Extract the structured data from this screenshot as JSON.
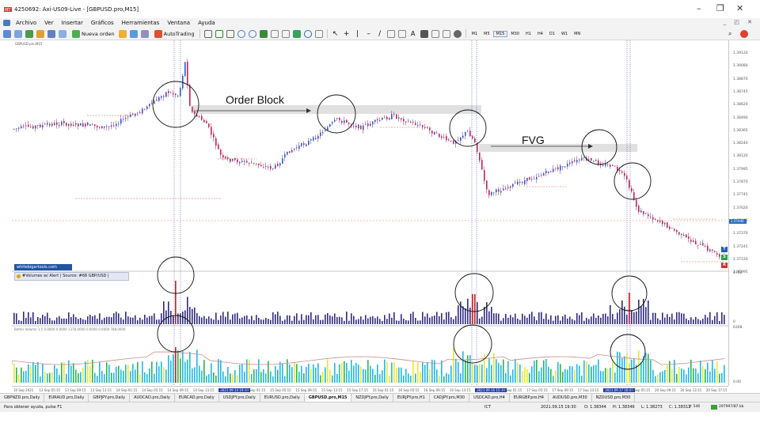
{
  "window": {
    "title": "4250692: Axi-US09-Live - [GBPUSD.pro,M15]",
    "minimize": "–",
    "maximize": "❐",
    "close": "✕"
  },
  "menu": {
    "items": [
      "Archivo",
      "Ver",
      "Insertar",
      "Gráficos",
      "Herramientas",
      "Ventana",
      "Ayuda"
    ],
    "mdi_controls": "_ ◰ ✕"
  },
  "toolbar": {
    "new_order": "Nueva orden",
    "autotrading": "AutoTrading",
    "timeframes": [
      "M1",
      "M5",
      "M15",
      "M30",
      "H1",
      "H4",
      "D1",
      "W1",
      "MN"
    ],
    "active_timeframe": "M15"
  },
  "chart": {
    "symbol_label": "GBPUSD.pro,M15",
    "watermark": "whitebigartools.com",
    "indicator1_label": "#Volumes w/ Alert | Source: #68 GBP/USD |",
    "indicator2_label": "Better Volume 1.5 0.0000 0.0000 1378.0000 0.0000 0.0000 788.0000",
    "annotation_order_block": "Order Block",
    "annotation_fvg": "FVG",
    "price_axis": [
      "1.39120",
      "1.39080",
      "1.38870",
      "1.38745",
      "1.38620",
      "1.38490",
      "1.38365",
      "1.38240",
      "1.38120",
      "1.37995",
      "1.37870",
      "1.37745",
      "1.37620",
      "1.37495",
      "1.37370",
      "1.37245",
      "1.37120",
      "1.36995"
    ],
    "current_price": "1.37440",
    "volume_axis": [
      "4762",
      "0"
    ],
    "better_volume_axis": [
      "6308",
      "0.00"
    ],
    "badges": [
      {
        "letter": "T",
        "color": "#1f5fb8"
      },
      {
        "letter": "S",
        "color": "#2e9e44"
      },
      {
        "letter": "R",
        "color": "#d03030"
      }
    ],
    "colors": {
      "bull": "#2a5bd6",
      "bear": "#c82050",
      "wick": "#7a2a7a",
      "level": "#e45e3a",
      "vol_bar": "#302a80",
      "vol_spike": "#cc1e1e",
      "bv_cyan": "#1fb8e8",
      "bv_green": "#2bb44a",
      "bv_yellow": "#e8e82a",
      "ma_line": "#c98a8a",
      "vline": "#3040c0",
      "zone": "#d8d8d8"
    }
  },
  "time_axis": {
    "labels": [
      "10 Sep 2021",
      "13 Sep 05:15",
      "13 Sep 09:15",
      "13 Sep 13:15",
      "14 Sep 01:15",
      "14 Sep 05:15",
      "14 Sep 09:15",
      "14 Sep 13:15",
      "2021.09.14 19:30",
      "15 Sep 01:15",
      "15 Sep 05:15",
      "15 Sep 09:15",
      "15 Sep 13:15",
      "15 Sep 17:15",
      "16 Sep 01:15",
      "16 Sep 05:15",
      "16 Sep 09:15",
      "16 Sep 13:15",
      "2021.09.16 15:30",
      "17 Sep 01:15",
      "17 Sep 05:15",
      "17 Sep 09:15",
      "17 Sep 13:15",
      "2021.09.17 16:45",
      "20 Sep 05:15",
      "20 Sep 09:15",
      "20 Sep 13:15",
      "20 Sep 17:15"
    ],
    "highlighted": [
      "2021.09.14 19:30",
      "2021.09.16 15:30",
      "2021.09.17 16:45"
    ]
  },
  "tabs": {
    "items": [
      "GBPNZD.pro,Daily",
      "EURAUD.pro,Daily",
      "GBPJPY.pro,Daily",
      "AUDCAD.pro,Daily",
      "EURCAD.pro,Daily",
      "USDJPY.pro,Daily",
      "EURUSD.pro,Daily",
      "GBPUSD.pro,M15",
      "NZDJPY.pro,Daily",
      "EURJPY.pro,H1",
      "CADJPY.pro,M30",
      "USDCAD.pro,H4",
      "EURGBP.pro,H4",
      "AUDUSD.pro,M30",
      "NZDUSD.pro,M30"
    ],
    "active": "GBPUSD.pro,M15"
  },
  "status": {
    "help": "Para obtener ayuda, pulse F1",
    "profile": "ICT",
    "datetime": "2021.09.15 19:30",
    "open": "O: 1.38344",
    "high": "H: 1.38346",
    "low": "L: 1.38273",
    "close": "C: 1.38312",
    "volume": "V: 546",
    "traffic": "297997/87 kb"
  }
}
